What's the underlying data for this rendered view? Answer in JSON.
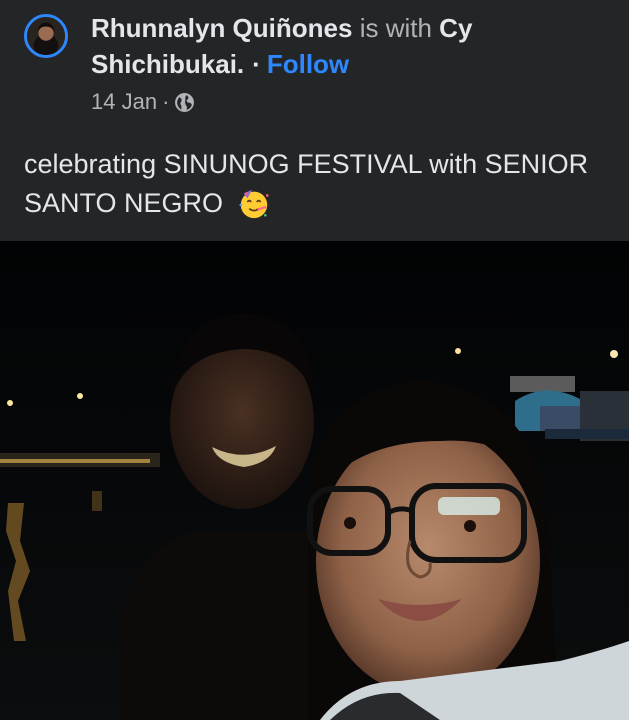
{
  "post": {
    "author": "Rhunnalyn Quiñones",
    "with_text": "is with",
    "tagged": "Cy Shichibukai.",
    "follow_label": "Follow",
    "date": "14 Jan",
    "privacy_icon": "globe-icon",
    "caption": "celebrating SINUNOG FESTIVAL with SENIOR SANTO NEGRO",
    "caption_emoji": "partying-face-emoji"
  },
  "colors": {
    "background": "#242526",
    "text": "#e4e6eb",
    "muted": "#b0b3b8",
    "link": "#2d88ff"
  }
}
